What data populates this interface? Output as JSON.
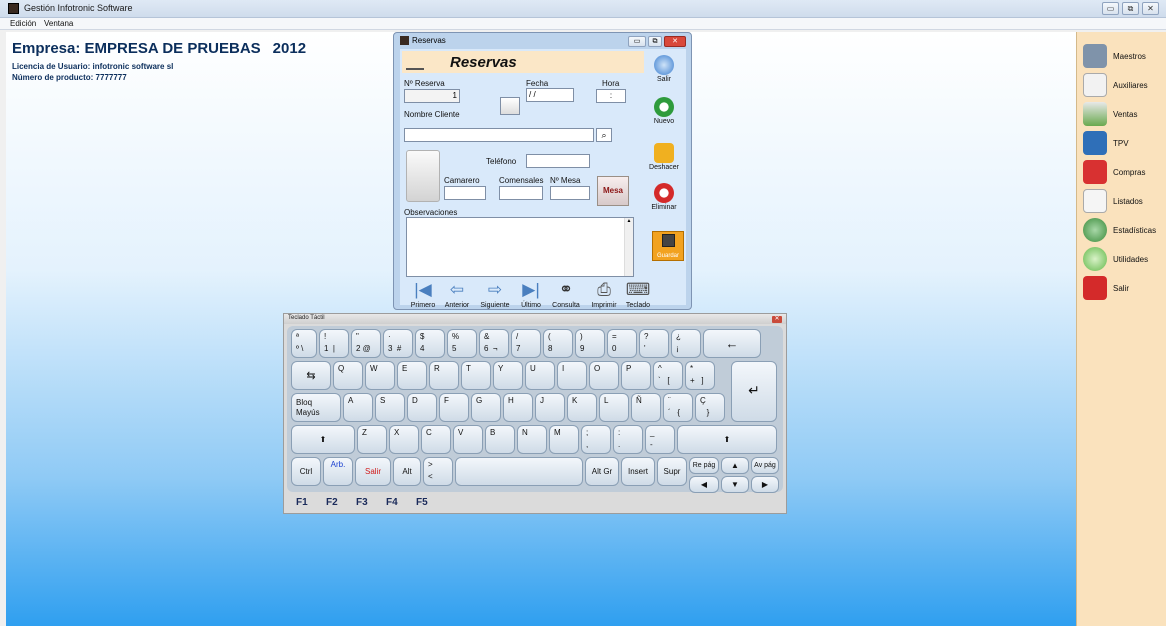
{
  "app": {
    "title": "Gestión Infotronic Software",
    "menu": [
      "Edición",
      "Ventana"
    ],
    "window_buttons": {
      "minimize": "▭",
      "restore": "⧉",
      "close": "✕"
    }
  },
  "header": {
    "company_label": "Empresa: EMPRESA DE PRUEBAS",
    "year": "2012",
    "license": "Licencia de Usuario: infotronic software sl",
    "product": "Número de producto: 7777777"
  },
  "sidebar": {
    "items": [
      {
        "label": "Maestros",
        "icon": "database-icon",
        "color": "#7f93aa"
      },
      {
        "label": "Auxiliares",
        "icon": "documents-icon",
        "color": "#f2f2f2"
      },
      {
        "label": "Ventas",
        "icon": "chart-icon",
        "color": "#6aa94f"
      },
      {
        "label": "TPV",
        "icon": "monitor-icon",
        "color": "#2f6fb8"
      },
      {
        "label": "Compras",
        "icon": "cart-icon",
        "color": "#d83131"
      },
      {
        "label": "Listados",
        "icon": "list-icon",
        "color": "#f5f5f5"
      },
      {
        "label": "Estadísticas",
        "icon": "pie-icon",
        "color": "#3a8a3a"
      },
      {
        "label": "Utilidades",
        "icon": "gear-icon",
        "color": "#62b84a"
      },
      {
        "label": "Salir",
        "icon": "power-icon",
        "color": "#d42a2a"
      }
    ]
  },
  "reservas": {
    "window_title": "Reservas",
    "header_title": "Reservas",
    "labels": {
      "numero": "Nº Reserva",
      "fecha": "Fecha",
      "hora": "Hora",
      "cliente": "Nombre Cliente",
      "telefono": "Teléfono",
      "camarero": "Camarero",
      "comensales": "Comensales",
      "mesa_num": "Nº Mesa",
      "observaciones": "Observaciones"
    },
    "values": {
      "numero": "1",
      "fecha": " / /",
      "hora": ":",
      "cliente": "",
      "telefono": "",
      "camarero": "",
      "comensales": "",
      "mesa_num": ""
    },
    "mesa_button": "Mesa",
    "actions": [
      {
        "label": "Salir",
        "icon": "power-icon",
        "color": "#3b7fd0"
      },
      {
        "label": "Nuevo",
        "icon": "new-doc-icon",
        "color": "#2e9b3c"
      },
      {
        "label": "Deshacer",
        "icon": "undo-icon",
        "color": "#f0b020"
      },
      {
        "label": "Eliminar",
        "icon": "delete-icon",
        "color": "#d42a2a"
      }
    ],
    "guardar": "Guardar",
    "nav": [
      {
        "label": "Primero",
        "icon": "first-icon",
        "glyph": "|◀"
      },
      {
        "label": "Anterior",
        "icon": "prev-icon",
        "glyph": "⇦"
      },
      {
        "label": "Siguiente",
        "icon": "next-icon",
        "glyph": "⇨"
      },
      {
        "label": "Último",
        "icon": "last-icon",
        "glyph": "▶|"
      },
      {
        "label": "Consulta",
        "icon": "binoculars-icon",
        "glyph": "⚭"
      },
      {
        "label": "Imprimir",
        "icon": "printer-icon",
        "glyph": "⎙"
      },
      {
        "label": "Teclado",
        "icon": "keyboard-icon",
        "glyph": "⌨"
      }
    ]
  },
  "keyboard": {
    "title": "Teclado Táctil",
    "row1": [
      {
        "top": "ª",
        "bottom": "º \\"
      },
      {
        "top": "!",
        "bottom": "1  |"
      },
      {
        "top": "\"",
        "bottom": "2 @"
      },
      {
        "top": "·",
        "bottom": "3  #"
      },
      {
        "top": "$",
        "bottom": "4"
      },
      {
        "top": "%",
        "bottom": "5"
      },
      {
        "top": "&",
        "bottom": "6  ¬"
      },
      {
        "top": "/",
        "bottom": "7"
      },
      {
        "top": "(",
        "bottom": "8"
      },
      {
        "top": ")",
        "bottom": "9"
      },
      {
        "top": "=",
        "bottom": "0"
      },
      {
        "top": "?",
        "bottom": "'"
      },
      {
        "top": "¿",
        "bottom": "¡"
      }
    ],
    "backspace": "←",
    "tab": "⇆",
    "row2": [
      "Q",
      "W",
      "E",
      "R",
      "T",
      "Y",
      "U",
      "I",
      "O",
      "P"
    ],
    "row2_extra": [
      {
        "top": "^",
        "bottom": "`   ["
      },
      {
        "top": "*",
        "bottom": "+   ]"
      }
    ],
    "enter": "↵",
    "caps": "Bloq\nMayús",
    "row3": [
      "A",
      "S",
      "D",
      "F",
      "G",
      "H",
      "J",
      "K",
      "L",
      "Ñ"
    ],
    "row3_extra": [
      {
        "top": "¨",
        "bottom": "´   {"
      },
      {
        "top": "Ç",
        "bottom": "   }"
      }
    ],
    "shift": "⬆",
    "row4": [
      "Z",
      "X",
      "C",
      "V",
      "B",
      "N",
      "M"
    ],
    "row4_extra": [
      {
        "top": ";",
        "bottom": ","
      },
      {
        "top": ":",
        "bottom": "."
      },
      {
        "top": "_",
        "bottom": "-"
      }
    ],
    "row5": {
      "ctrl": "Ctrl",
      "arb": "Arb.",
      "salir": "Salir",
      "alt": "Alt",
      "angle_top": ">",
      "angle_bottom": "<",
      "altgr": "Alt Gr",
      "insert": "Insert",
      "supr": "Supr",
      "repag": "Re pág",
      "up": "▲",
      "avpag": "Av pág",
      "left": "◀",
      "down": "▼",
      "right": "▶"
    },
    "fkeys": [
      "F1",
      "F2",
      "F3",
      "F4",
      "F5"
    ]
  }
}
